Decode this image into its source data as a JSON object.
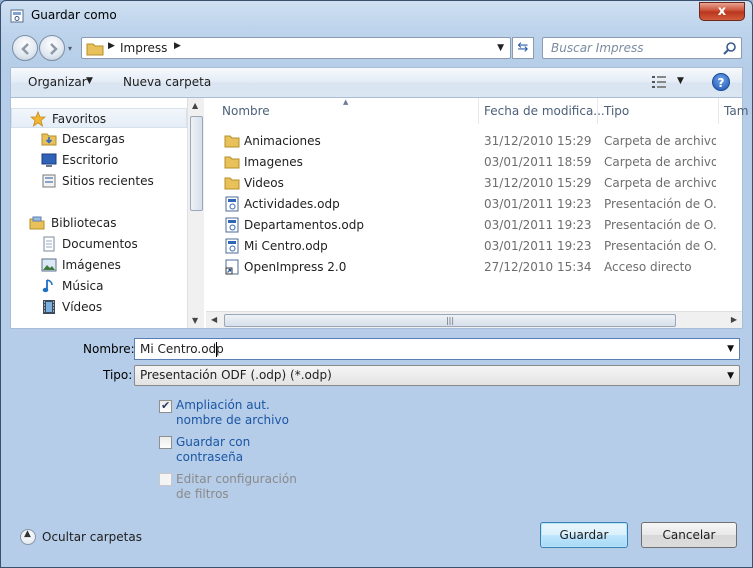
{
  "window": {
    "title": "Guardar como",
    "close_glyph": "x"
  },
  "address_bar": {
    "path": "Impress",
    "search_placeholder": "Buscar Impress"
  },
  "toolbar": {
    "organize_label": "Organizar",
    "new_folder_label": "Nueva carpeta",
    "help_glyph": "?"
  },
  "nav_pane": {
    "items": [
      {
        "label": "Favoritos",
        "icon": "star-icon"
      },
      {
        "label": "Descargas",
        "icon": "downloads-folder-icon"
      },
      {
        "label": "Escritorio",
        "icon": "desktop-icon"
      },
      {
        "label": "Sitios recientes",
        "icon": "recent-places-icon"
      },
      {
        "label": "Bibliotecas",
        "icon": "libraries-icon"
      },
      {
        "label": "Documentos",
        "icon": "documents-icon"
      },
      {
        "label": "Imágenes",
        "icon": "pictures-icon"
      },
      {
        "label": "Música",
        "icon": "music-icon"
      },
      {
        "label": "Vídeos",
        "icon": "videos-icon"
      }
    ]
  },
  "file_list": {
    "columns": [
      "Nombre",
      "Fecha de modifica...",
      "Tipo",
      "Tam"
    ],
    "rows": [
      {
        "name": "Animaciones",
        "date": "31/12/2010 15:29",
        "type": "Carpeta de archivos",
        "icon": "folder-icon"
      },
      {
        "name": "Imagenes",
        "date": "03/01/2011 18:59",
        "type": "Carpeta de archivos",
        "icon": "folder-icon"
      },
      {
        "name": "Videos",
        "date": "31/12/2010 15:29",
        "type": "Carpeta de archivos",
        "icon": "folder-icon"
      },
      {
        "name": "Actividades.odp",
        "date": "03/01/2011 19:23",
        "type": "Presentación de O...",
        "icon": "presentation-file-icon"
      },
      {
        "name": "Departamentos.odp",
        "date": "03/01/2011 19:23",
        "type": "Presentación de O...",
        "icon": "presentation-file-icon"
      },
      {
        "name": "Mi Centro.odp",
        "date": "03/01/2011 19:23",
        "type": "Presentación de O...",
        "icon": "presentation-file-icon"
      },
      {
        "name": "OpenImpress 2.0",
        "date": "27/12/2010 15:34",
        "type": "Acceso directo",
        "icon": "shortcut-icon"
      }
    ]
  },
  "form": {
    "name_label": "Nombre:",
    "name_value": "Mi Centro.odp",
    "type_label": "Tipo:",
    "type_value": "Presentación ODF (.odp) (*.odp)",
    "options": [
      {
        "label": "Ampliación aut. nombre de archivo",
        "checked": true,
        "enabled": true
      },
      {
        "label": "Guardar con contraseña",
        "checked": false,
        "enabled": true
      },
      {
        "label": "Editar configuración de filtros",
        "checked": false,
        "enabled": false
      }
    ]
  },
  "footer": {
    "hide_folders_label": "Ocultar carpetas",
    "save_label": "Guardar",
    "cancel_label": "Cancelar"
  },
  "colors": {
    "accent": "#1b56a5",
    "close_button": "#c7442c",
    "folder": "#e8c15a"
  }
}
